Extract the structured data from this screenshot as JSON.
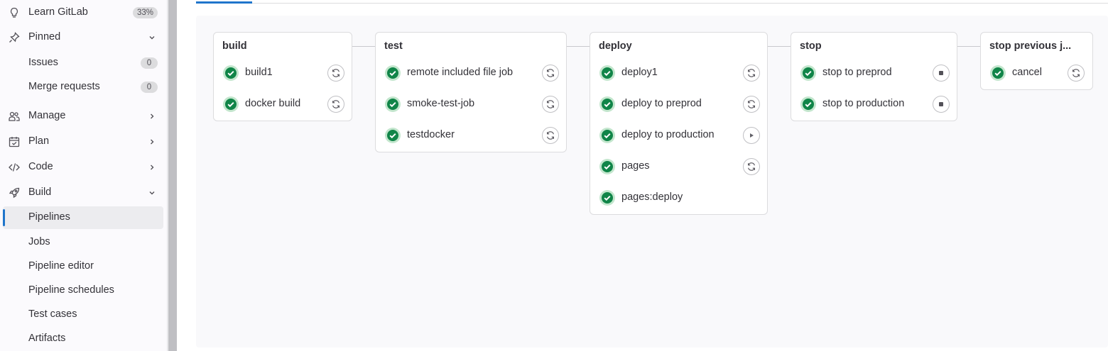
{
  "sidebar": {
    "items": [
      {
        "label": "Learn GitLab",
        "badge": "33%",
        "icon": "bulb-icon"
      },
      {
        "label": "Pinned",
        "icon": "pin-icon",
        "chevron": "down"
      },
      {
        "label": "Issues",
        "badge": "0"
      },
      {
        "label": "Merge requests",
        "badge": "0"
      },
      {
        "label": "Manage",
        "icon": "users-icon",
        "chevron": "right"
      },
      {
        "label": "Plan",
        "icon": "calendar-icon",
        "chevron": "right"
      },
      {
        "label": "Code",
        "icon": "code-icon",
        "chevron": "right"
      },
      {
        "label": "Build",
        "icon": "rocket-icon",
        "chevron": "down"
      },
      {
        "label": "Pipelines",
        "active": true
      },
      {
        "label": "Jobs"
      },
      {
        "label": "Pipeline editor"
      },
      {
        "label": "Pipeline schedules"
      },
      {
        "label": "Test cases"
      },
      {
        "label": "Artifacts"
      }
    ]
  },
  "pipeline": {
    "stages": [
      {
        "name": "build",
        "jobs": [
          {
            "name": "build1",
            "status": "success",
            "action": "retry"
          },
          {
            "name": "docker build",
            "status": "success",
            "action": "retry"
          }
        ]
      },
      {
        "name": "test",
        "jobs": [
          {
            "name": "remote included file job",
            "status": "success",
            "action": "retry"
          },
          {
            "name": "smoke-test-job",
            "status": "success",
            "action": "retry"
          },
          {
            "name": "testdocker",
            "status": "success",
            "action": "retry"
          }
        ]
      },
      {
        "name": "deploy",
        "jobs": [
          {
            "name": "deploy1",
            "status": "success",
            "action": "retry"
          },
          {
            "name": "deploy to preprod",
            "status": "success",
            "action": "retry"
          },
          {
            "name": "deploy to production",
            "status": "success",
            "action": "play"
          },
          {
            "name": "pages",
            "status": "success",
            "action": "retry"
          },
          {
            "name": "pages:deploy",
            "status": "success",
            "action": ""
          }
        ]
      },
      {
        "name": "stop",
        "jobs": [
          {
            "name": "stop to preprod",
            "status": "success",
            "action": "stop"
          },
          {
            "name": "stop to production",
            "status": "success",
            "action": "stop"
          }
        ]
      },
      {
        "name": "stop previous j...",
        "jobs": [
          {
            "name": "cancel",
            "status": "success",
            "action": "retry"
          }
        ]
      }
    ]
  },
  "colors": {
    "success": "#108548",
    "accent": "#1f75cb"
  }
}
